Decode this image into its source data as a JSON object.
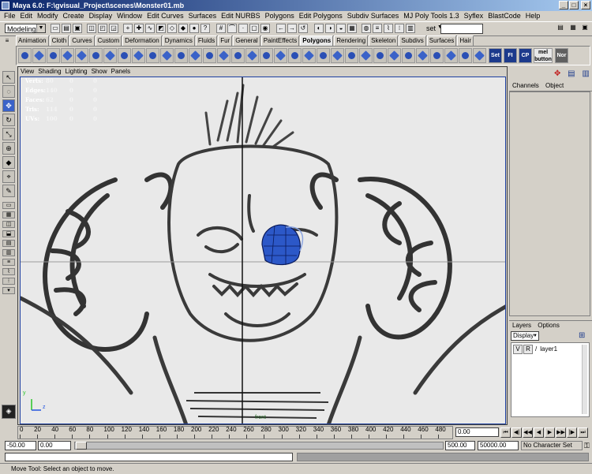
{
  "window": {
    "title": "Maya 6.0: F:\\gvisual_Project\\scenes\\Monster01.mb",
    "minimize": "_",
    "maximize": "□",
    "close": "×"
  },
  "menu": [
    "File",
    "Edit",
    "Modify",
    "Create",
    "Display",
    "Window",
    "Edit Curves",
    "Surfaces",
    "Edit NURBS",
    "Polygons",
    "Edit Polygons",
    "Subdiv Surfaces",
    "MJ Poly Tools 1.3",
    "Syflex",
    "BlastCode",
    "Help"
  ],
  "status_line": {
    "mode": "Modeling",
    "selection_set_label": "set",
    "selection_set_value": ""
  },
  "shelf_tabs": [
    "Animation",
    "Cloth",
    "Curves",
    "Custom",
    "Deformation",
    "Dynamics",
    "Fluids",
    "Fur",
    "General",
    "PaintEffects",
    "Polygons",
    "Rendering",
    "Skeleton",
    "Subdivs",
    "Surfaces",
    "Hair"
  ],
  "active_shelf_tab": "Polygons",
  "shelf_text_buttons": [
    "Set",
    "FI",
    "CP",
    "mel button",
    "Nor"
  ],
  "viewport": {
    "menu": [
      "View",
      "Shading",
      "Lighting",
      "Show",
      "Panels"
    ],
    "stats": [
      {
        "label": "Verts:",
        "values": [
          "80",
          "0",
          "0"
        ]
      },
      {
        "label": "Edges:",
        "values": [
          "140",
          "0",
          "0"
        ]
      },
      {
        "label": "Faces:",
        "values": [
          "62",
          "0",
          "0"
        ]
      },
      {
        "label": "Tris:",
        "values": [
          "114",
          "0",
          "0"
        ]
      },
      {
        "label": "UVs:",
        "values": [
          "100",
          "0",
          "0"
        ]
      }
    ],
    "camera_label": "front",
    "axis_labels": [
      "y",
      "z"
    ]
  },
  "channel_box": {
    "tabs": [
      "Channels",
      "Object"
    ]
  },
  "layers": {
    "tabs": [
      "Layers",
      "Options"
    ],
    "mode": "Display",
    "items": [
      {
        "v": "V",
        "r": "R",
        "name": "layer1"
      }
    ]
  },
  "time": {
    "ticks": [
      "0",
      "20",
      "40",
      "60",
      "80",
      "100",
      "120",
      "140",
      "160",
      "180",
      "200",
      "220",
      "240",
      "260",
      "280",
      "300",
      "320",
      "340",
      "360",
      "380",
      "400",
      "420",
      "440",
      "460",
      "480"
    ],
    "current_frame": "0.00",
    "range_start": "-50.00",
    "playback_start": "0.00",
    "playback_end": "500.00",
    "range_end": "50000.00",
    "character_set": "No Character Set"
  },
  "help_line": "Move Tool: Select an object to move."
}
